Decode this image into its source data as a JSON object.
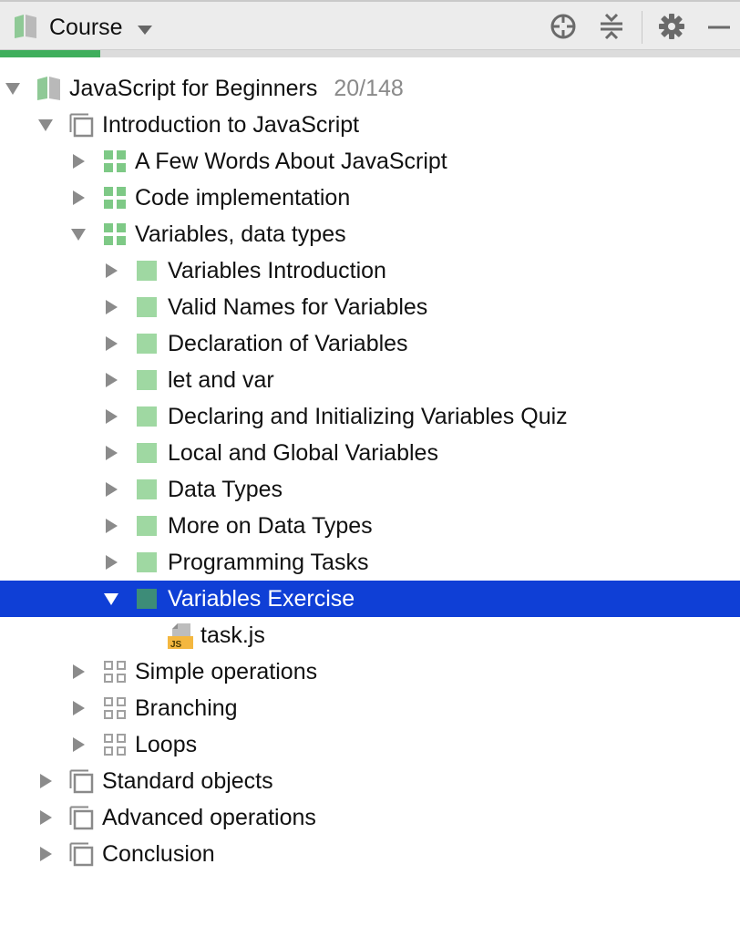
{
  "header": {
    "title": "Course",
    "progress_fraction": 0.135,
    "buttons": [
      "locate-icon",
      "collapse-all-icon",
      "gear-icon",
      "minimize-icon"
    ]
  },
  "tree": {
    "course": {
      "label": "JavaScript for Beginners",
      "count": "20/148"
    },
    "rows": [
      {
        "label": "Introduction to JavaScript"
      },
      {
        "label": "A Few Words About JavaScript"
      },
      {
        "label": "Code implementation"
      },
      {
        "label": "Variables, data types"
      },
      {
        "label": "Variables Introduction"
      },
      {
        "label": "Valid Names for Variables"
      },
      {
        "label": "Declaration of Variables"
      },
      {
        "label": "let and var"
      },
      {
        "label": "Declaring and Initializing Variables Quiz"
      },
      {
        "label": "Local and Global Variables"
      },
      {
        "label": "Data Types"
      },
      {
        "label": "More on Data Types"
      },
      {
        "label": "Programming Tasks"
      },
      {
        "label": "Variables Exercise"
      },
      {
        "label": "task.js"
      },
      {
        "label": "Simple operations"
      },
      {
        "label": "Branching"
      },
      {
        "label": "Loops"
      },
      {
        "label": "Standard objects"
      },
      {
        "label": "Advanced operations"
      },
      {
        "label": "Conclusion"
      }
    ]
  },
  "colors": {
    "selection": "#0f3fd6",
    "solved_task": "#9fd8a2",
    "selected_task": "#3d8c78",
    "progress": "#3fae5c"
  }
}
